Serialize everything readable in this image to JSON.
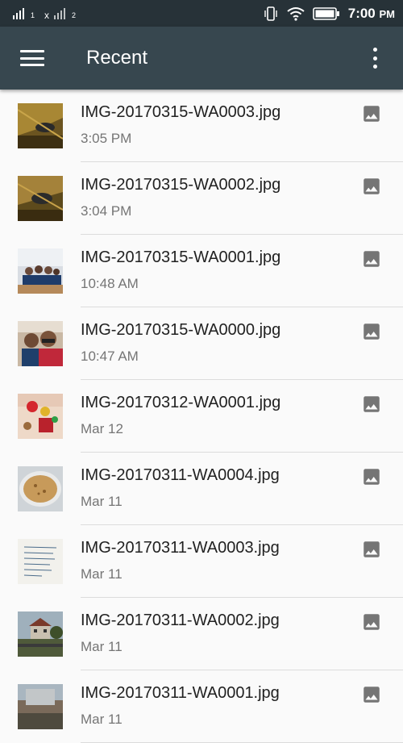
{
  "status_bar": {
    "sim1_label": "1",
    "sim2_label": "x",
    "sim2_sub": "2",
    "time": "7:00",
    "ampm": "PM",
    "icons": [
      "signal-icon",
      "vibrate-icon",
      "wifi-icon",
      "battery-icon"
    ]
  },
  "app_bar": {
    "title": "Recent",
    "icons": [
      "menu-icon",
      "more-vert-icon"
    ]
  },
  "files": [
    {
      "name": "IMG-20170315-WA0003.jpg",
      "date": "3:05 PM",
      "icon": "image-icon"
    },
    {
      "name": "IMG-20170315-WA0002.jpg",
      "date": "3:04 PM",
      "icon": "image-icon"
    },
    {
      "name": "IMG-20170315-WA0001.jpg",
      "date": "10:48 AM",
      "icon": "image-icon"
    },
    {
      "name": "IMG-20170315-WA0000.jpg",
      "date": "10:47 AM",
      "icon": "image-icon"
    },
    {
      "name": "IMG-20170312-WA0001.jpg",
      "date": "Mar 12",
      "icon": "image-icon"
    },
    {
      "name": "IMG-20170311-WA0004.jpg",
      "date": "Mar 11",
      "icon": "image-icon"
    },
    {
      "name": "IMG-20170311-WA0003.jpg",
      "date": "Mar 11",
      "icon": "image-icon"
    },
    {
      "name": "IMG-20170311-WA0002.jpg",
      "date": "Mar 11",
      "icon": "image-icon"
    },
    {
      "name": "IMG-20170311-WA0001.jpg",
      "date": "Mar 11",
      "icon": "image-icon"
    }
  ],
  "colors": {
    "status_bar_bg": "#273238",
    "app_bar_bg": "#37474f",
    "list_bg": "#fafafa",
    "icon_gray": "#757575"
  }
}
